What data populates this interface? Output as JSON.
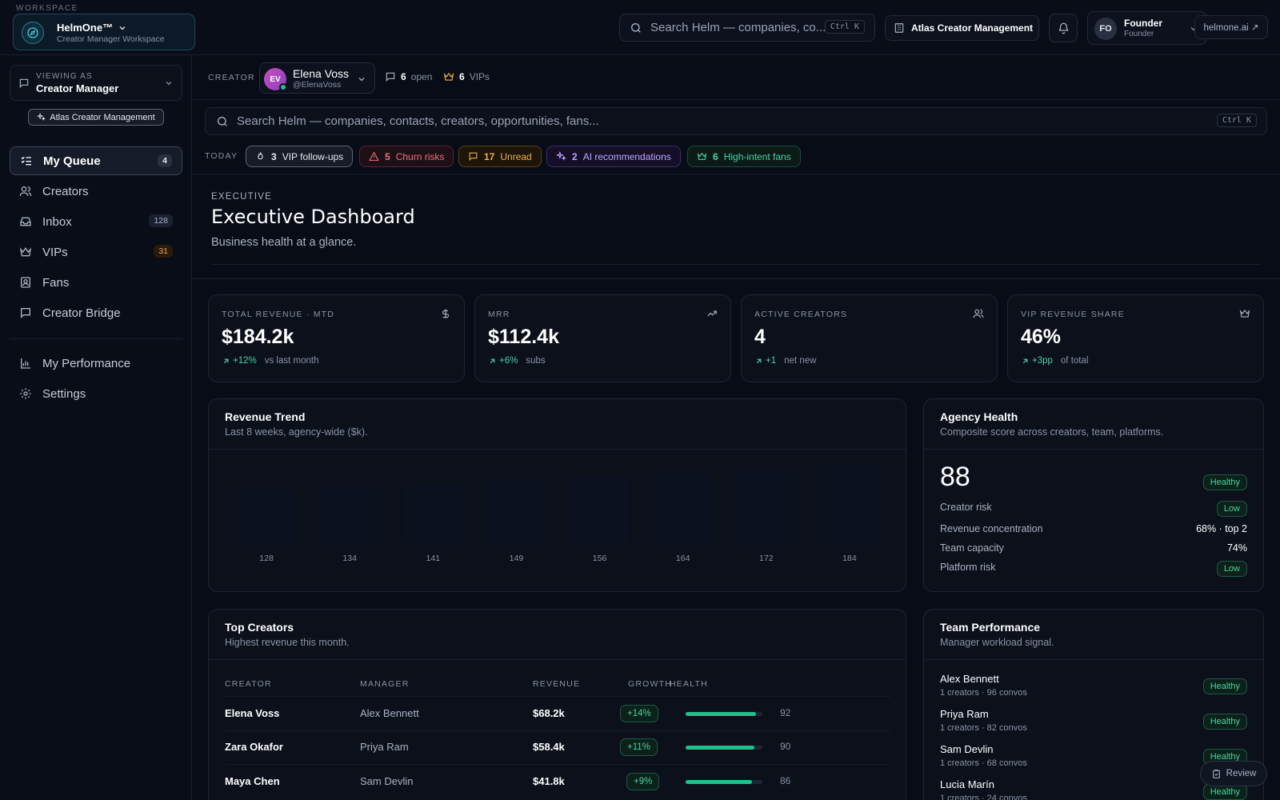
{
  "workspace": {
    "label": "WORKSPACE",
    "name": "HelmOne™",
    "subtitle": "Creator Manager Workspace"
  },
  "topbar": {
    "search_placeholder": "Search Helm — companies, co...",
    "shortcut": "Ctrl K",
    "org": "Atlas Creator Management",
    "user": {
      "initials": "FO",
      "name": "Founder",
      "role": "Founder"
    },
    "external_link": "helmone.ai ↗"
  },
  "sidebar": {
    "viewing_as_label": "VIEWING AS",
    "viewing_as_value": "Creator Manager",
    "org_pill": "Atlas Creator Management",
    "items": [
      {
        "label": "My Queue",
        "badge": "4"
      },
      {
        "label": "Creators",
        "badge": ""
      },
      {
        "label": "Inbox",
        "badge": "128"
      },
      {
        "label": "VIPs",
        "badge": "31"
      },
      {
        "label": "Fans",
        "badge": ""
      },
      {
        "label": "Creator Bridge",
        "badge": ""
      },
      {
        "label": "My Performance",
        "badge": ""
      },
      {
        "label": "Settings",
        "badge": ""
      }
    ]
  },
  "creator_bar": {
    "label": "CREATOR",
    "avatar_initials": "EV",
    "name": "Elena Voss",
    "handle": "@ElenaVoss",
    "open_count": "6",
    "open_label": "open",
    "vip_count": "6",
    "vip_label": "VIPs"
  },
  "main_search": {
    "placeholder": "Search Helm — companies, contacts, creators, opportunities, fans...",
    "shortcut": "Ctrl K"
  },
  "today": {
    "label": "TODAY",
    "chips": [
      {
        "count": "3",
        "label": "VIP follow-ups"
      },
      {
        "count": "5",
        "label": "Churn risks"
      },
      {
        "count": "17",
        "label": "Unread"
      },
      {
        "count": "2",
        "label": "AI recommendations"
      },
      {
        "count": "6",
        "label": "High-intent fans"
      }
    ]
  },
  "page": {
    "eyebrow": "EXECUTIVE",
    "title": "Executive Dashboard",
    "subtitle": "Business health at a glance."
  },
  "kpis": [
    {
      "label": "TOTAL REVENUE · MTD",
      "value": "$184.2k",
      "delta": "+12%",
      "context": "vs last month",
      "icon": "dollar-icon"
    },
    {
      "label": "MRR",
      "value": "$112.4k",
      "delta": "+6%",
      "context": "subs",
      "icon": "trending-up-icon"
    },
    {
      "label": "ACTIVE CREATORS",
      "value": "4",
      "delta": "+1",
      "context": "net new",
      "icon": "users-icon"
    },
    {
      "label": "VIP REVENUE SHARE",
      "value": "46%",
      "delta": "+3pp",
      "context": "of total",
      "icon": "crown-icon"
    }
  ],
  "revenue_trend": {
    "title": "Revenue Trend",
    "subtitle": "Last 8 weeks, agency-wide ($k)."
  },
  "chart_data": {
    "type": "bar",
    "categories": [
      "128",
      "134",
      "141",
      "149",
      "156",
      "164",
      "172",
      "184"
    ],
    "values": [
      128,
      134,
      141,
      149,
      156,
      164,
      172,
      184
    ],
    "title": "Revenue Trend",
    "xlabel": "",
    "ylabel": ""
  },
  "agency_health": {
    "title": "Agency Health",
    "subtitle": "Composite score across creators, team, platforms.",
    "score": "88",
    "status": "Healthy",
    "rows": [
      {
        "label": "Creator risk",
        "value": "Low",
        "type": "pill"
      },
      {
        "label": "Revenue concentration",
        "value": "68% · top 2",
        "type": "text"
      },
      {
        "label": "Team capacity",
        "value": "74%",
        "type": "text"
      },
      {
        "label": "Platform risk",
        "value": "Low",
        "type": "pill"
      }
    ]
  },
  "top_creators": {
    "title": "Top Creators",
    "subtitle": "Highest revenue this month.",
    "columns": [
      "CREATOR",
      "MANAGER",
      "REVENUE",
      "GROWTH",
      "HEALTH"
    ],
    "rows": [
      {
        "creator": "Elena Voss",
        "manager": "Alex Bennett",
        "revenue": "$68.2k",
        "growth": "+14%",
        "health": "92"
      },
      {
        "creator": "Zara Okafor",
        "manager": "Priya Ram",
        "revenue": "$58.4k",
        "growth": "+11%",
        "health": "90"
      },
      {
        "creator": "Maya Chen",
        "manager": "Sam Devlin",
        "revenue": "$41.8k",
        "growth": "+9%",
        "health": "86"
      }
    ]
  },
  "team_performance": {
    "title": "Team Performance",
    "subtitle": "Manager workload signal.",
    "rows": [
      {
        "name": "Alex Bennett",
        "meta": "1 creators · 96 convos",
        "status": "Healthy"
      },
      {
        "name": "Priya Ram",
        "meta": "1 creators · 82 convos",
        "status": "Healthy"
      },
      {
        "name": "Sam Devlin",
        "meta": "1 creators · 68 convos",
        "status": "Healthy"
      },
      {
        "name": "Lucia Marín",
        "meta": "1 creators · 24 convos",
        "status": "Healthy"
      }
    ]
  },
  "review_button": "Review"
}
